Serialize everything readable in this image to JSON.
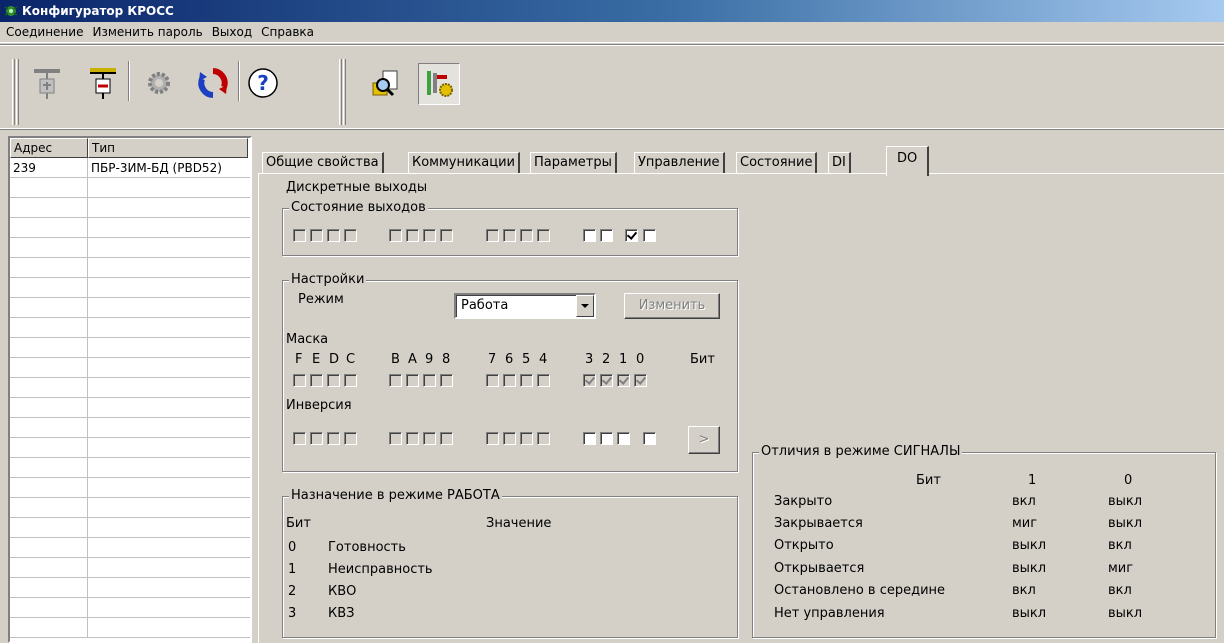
{
  "window": {
    "title": "Конфигуратор КРОСС"
  },
  "menu": [
    "Соединение",
    "Изменить пароль",
    "Выход",
    "Справка"
  ],
  "toolbar_icons": [
    "device-disconnect-icon",
    "device-connect-icon",
    "settings-gear-icon",
    "refresh-icon",
    "help-icon",
    "search-config-icon",
    "tools-icon"
  ],
  "list": {
    "headers": [
      "Адрес",
      "Тип"
    ],
    "rows": [
      {
        "address": "239",
        "type": "ПБР-3ИМ-БД (PBD52)"
      }
    ]
  },
  "tabs": [
    "Общие свойства",
    "Коммуникации",
    "Параметры",
    "Управление",
    "Состояние",
    "DI",
    "DO"
  ],
  "active_tab": "DO",
  "do": {
    "title": "Дискретные выходы",
    "outputs_group": "Состояние выходов",
    "settings_group": "Настройки",
    "mode_label": "Режим",
    "mode_value": "Работа",
    "change_button": "Изменить",
    "mask_label": "Маска",
    "bit_labels": [
      "F",
      "E",
      "D",
      "C",
      "B",
      "A",
      "9",
      "8",
      "7",
      "6",
      "5",
      "4",
      "3",
      "2",
      "1",
      "0"
    ],
    "bit_word": "Бит",
    "inversion_label": "Инверсия",
    "apply_button": ">",
    "work_group": "Назначение в режиме РАБОТА",
    "work_headers": [
      "Бит",
      "Значение"
    ],
    "work_rows": [
      {
        "bit": "0",
        "value": "Готовность"
      },
      {
        "bit": "1",
        "value": "Неисправность"
      },
      {
        "bit": "2",
        "value": "КВО"
      },
      {
        "bit": "3",
        "value": "КВЗ"
      }
    ],
    "signals_group": "Отличия в режиме СИГНАЛЫ",
    "signals_headers": [
      "Бит",
      "1",
      "0"
    ],
    "signals_rows": [
      {
        "name": "Закрыто",
        "v1": "вкл",
        "v0": "выкл"
      },
      {
        "name": "Закрывается",
        "v1": "миг",
        "v0": "выкл"
      },
      {
        "name": "Открыто",
        "v1": "выкл",
        "v0": "вкл"
      },
      {
        "name": "Открывается",
        "v1": "выкл",
        "v0": "миг"
      },
      {
        "name": "Остановлено в середине",
        "v1": "вкл",
        "v0": "вкл"
      },
      {
        "name": "Нет управления",
        "v1": "выкл",
        "v0": "выкл"
      }
    ]
  }
}
